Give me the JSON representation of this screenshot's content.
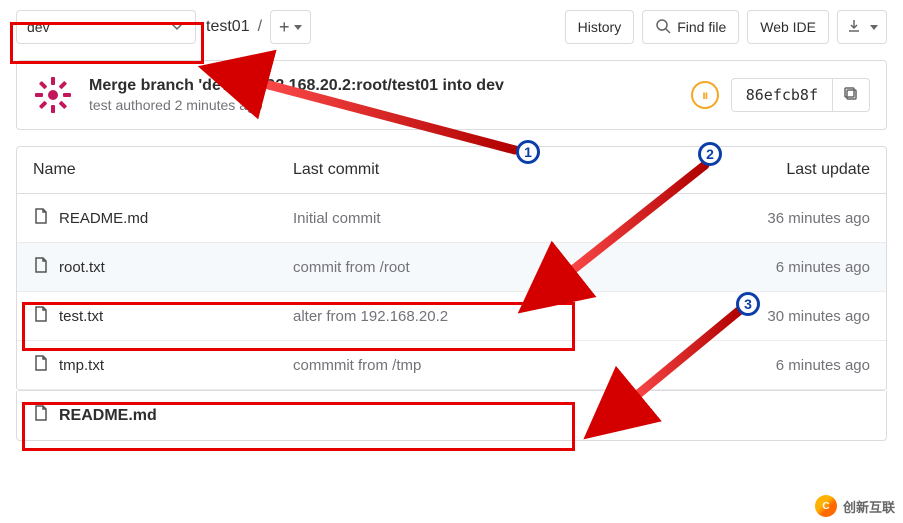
{
  "branch": "dev",
  "breadcrumb": {
    "repo": "test01",
    "sep": "/"
  },
  "actions": {
    "history": "History",
    "find": "Find file",
    "ide": "Web IDE"
  },
  "commit": {
    "title": "Merge branch 'dev' of 192.168.20.2:root/test01 into dev",
    "meta": "test authored 2 minutes ago",
    "sha": "86efcb8f"
  },
  "columns": {
    "name": "Name",
    "last_commit": "Last commit",
    "last_update": "Last update"
  },
  "files": [
    {
      "name": "README.md",
      "msg": "Initial commit",
      "updated": "36 minutes ago"
    },
    {
      "name": "root.txt",
      "msg": "commit from /root",
      "updated": "6 minutes ago"
    },
    {
      "name": "test.txt",
      "msg": "alter from 192.168.20.2",
      "updated": "30 minutes ago"
    },
    {
      "name": "tmp.txt",
      "msg": "commmit from /tmp",
      "updated": "6 minutes ago"
    }
  ],
  "readme_file": "README.md",
  "watermark": "创新互联"
}
